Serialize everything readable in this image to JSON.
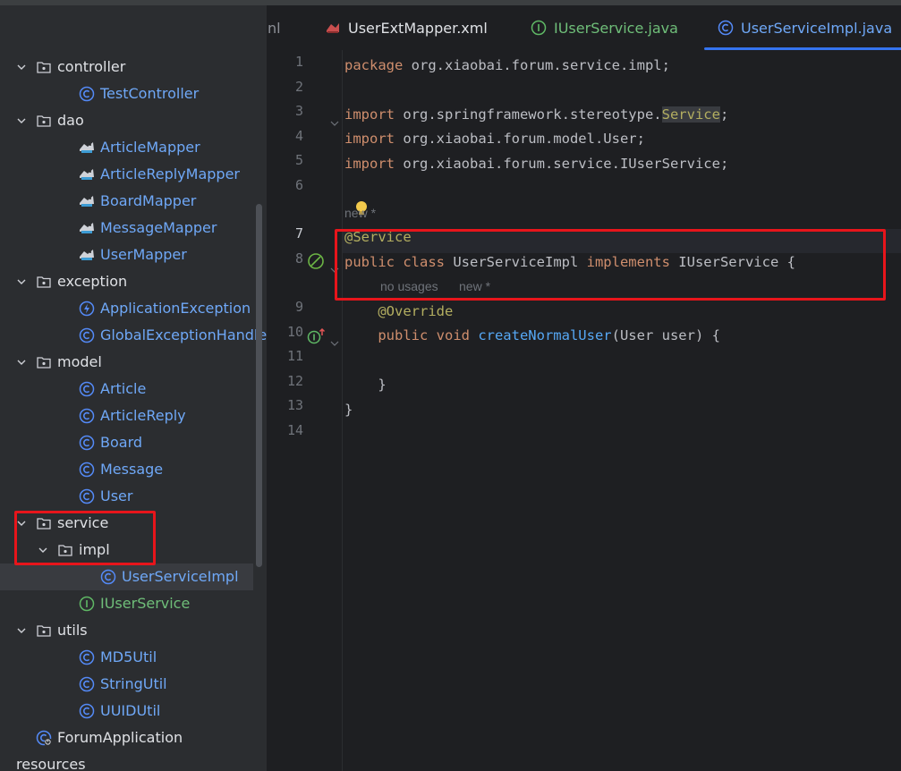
{
  "project_tree": [
    {
      "id": "controller",
      "label": "controller",
      "kind": "folder",
      "depth": 1,
      "expanded": true
    },
    {
      "id": "testcontroller",
      "label": "TestController",
      "kind": "class",
      "depth": 2
    },
    {
      "id": "dao",
      "label": "dao",
      "kind": "folder",
      "depth": 1,
      "expanded": true
    },
    {
      "id": "articlemapper",
      "label": "ArticleMapper",
      "kind": "mapper",
      "depth": 2
    },
    {
      "id": "articlereplymapper",
      "label": "ArticleReplyMapper",
      "kind": "mapper",
      "depth": 2
    },
    {
      "id": "boardmapper",
      "label": "BoardMapper",
      "kind": "mapper",
      "depth": 2
    },
    {
      "id": "messagemapper",
      "label": "MessageMapper",
      "kind": "mapper",
      "depth": 2
    },
    {
      "id": "usermapper",
      "label": "UserMapper",
      "kind": "mapper",
      "depth": 2
    },
    {
      "id": "exception",
      "label": "exception",
      "kind": "folder",
      "depth": 1,
      "expanded": true
    },
    {
      "id": "applicationexception",
      "label": "ApplicationException",
      "kind": "exception",
      "depth": 2
    },
    {
      "id": "globalexceptionhandler",
      "label": "GlobalExceptionHandler",
      "kind": "class",
      "depth": 2
    },
    {
      "id": "model",
      "label": "model",
      "kind": "folder",
      "depth": 1,
      "expanded": true
    },
    {
      "id": "article",
      "label": "Article",
      "kind": "class",
      "depth": 2
    },
    {
      "id": "articlereply",
      "label": "ArticleReply",
      "kind": "class",
      "depth": 2
    },
    {
      "id": "board",
      "label": "Board",
      "kind": "class",
      "depth": 2
    },
    {
      "id": "message",
      "label": "Message",
      "kind": "class",
      "depth": 2
    },
    {
      "id": "user",
      "label": "User",
      "kind": "class",
      "depth": 2
    },
    {
      "id": "service",
      "label": "service",
      "kind": "folder",
      "depth": 1,
      "expanded": true
    },
    {
      "id": "impl",
      "label": "impl",
      "kind": "folder",
      "depth": 2,
      "expanded": true
    },
    {
      "id": "userserviceimpl",
      "label": "UserServiceImpl",
      "kind": "class",
      "depth": 3,
      "selected": true
    },
    {
      "id": "iuserservice",
      "label": "IUserService",
      "kind": "interface",
      "depth": 2
    },
    {
      "id": "utils",
      "label": "utils",
      "kind": "folder",
      "depth": 1,
      "expanded": true
    },
    {
      "id": "md5util",
      "label": "MD5Util",
      "kind": "class",
      "depth": 2
    },
    {
      "id": "stringutil",
      "label": "StringUtil",
      "kind": "class",
      "depth": 2
    },
    {
      "id": "uuidutil",
      "label": "UUIDUtil",
      "kind": "class",
      "depth": 2
    },
    {
      "id": "forumapplication",
      "label": "ForumApplication",
      "kind": "app",
      "depth": 1
    },
    {
      "id": "resources",
      "label": "resources",
      "kind": "plain",
      "depth": 0
    }
  ],
  "tabs": {
    "partial": "nl",
    "mapper_xml": "UserExtMapper.xml",
    "iuserservice": "IUserService.java",
    "impl": "UserServiceImpl.java"
  },
  "line_numbers": [
    "1",
    "2",
    "3",
    "4",
    "5",
    "6",
    "7",
    "8",
    "9",
    "10",
    "11",
    "12",
    "13",
    "14"
  ],
  "code": {
    "l1_kw": "package",
    "l1_rest": " org.xiaobai.forum.service.impl;",
    "l3_kw": "import",
    "l3_pkg": " org.springframework.stereotype.",
    "l3_cls": "Service",
    "l3_end": ";",
    "l4_kw": "import",
    "l4_rest": " org.xiaobai.forum.model.User;",
    "l5_kw": "import",
    "l5_rest": " org.xiaobai.forum.service.IUserService;",
    "hint_new_class": "new *",
    "l7_ann": "@Service",
    "l8_kw1": "public",
    "l8_kw2": " class",
    "l8_name": " UserServiceImpl",
    "l8_kw3": " implements",
    "l8_rest": " IUserService {",
    "hint_no_usages": "no usages",
    "hint_new_method": "new *",
    "l9_ann": "    @Override",
    "l10_kw": "    public void",
    "l10_fn": " createNormalUser",
    "l10_rest": "(User user) {",
    "l12": "    }",
    "l13": "}"
  },
  "colors": {
    "keyword": "#cf8e6d",
    "annotation": "#b3ae60",
    "method": "#56a8f5",
    "class_label": "#6fa8f7",
    "interface_label": "#6fbe79",
    "highlight_box": "#e8151b",
    "active_tab_underline": "#3574f0"
  }
}
